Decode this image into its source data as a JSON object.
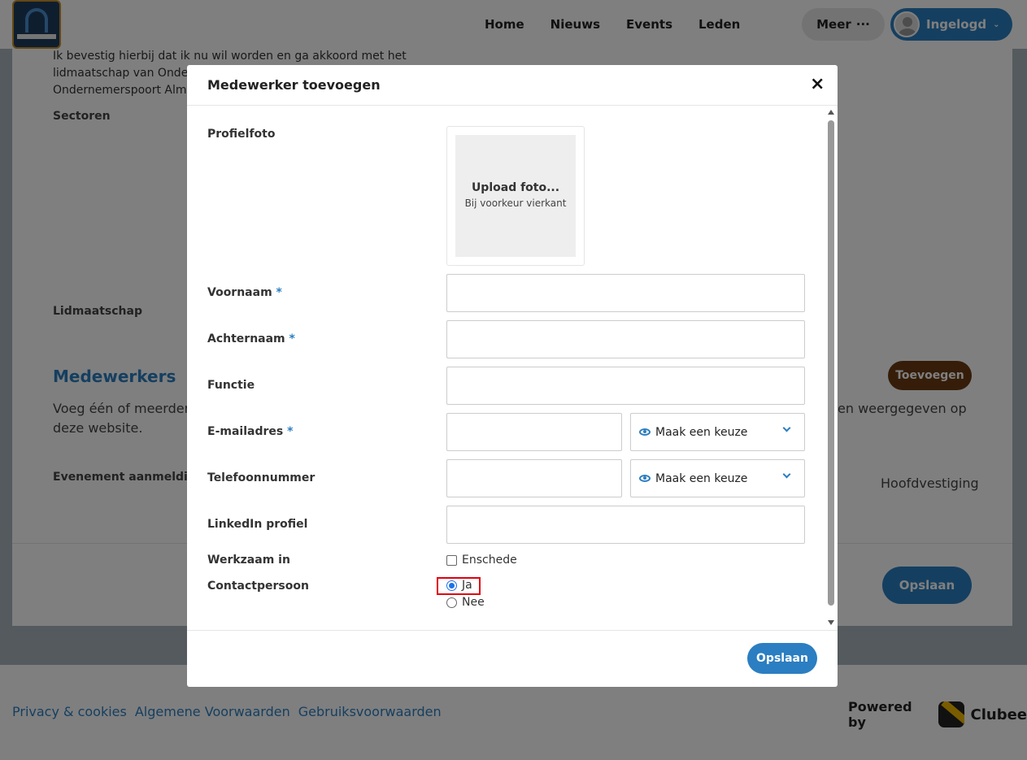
{
  "nav": {
    "links": [
      "Home",
      "Nieuws",
      "Events",
      "Leden"
    ],
    "meer_label": "Meer",
    "meer_icon": "···",
    "login_label": "Ingelogd"
  },
  "background": {
    "consent_lines": [
      "Ik bevestig hierbij dat ik nu wil worden en ga akkoord met het",
      "lidmaatschap van Onder",
      "Ondernemerspoort Alme"
    ],
    "sectoren_label": "Sectoren",
    "lidmaatschap_label": "Lidmaatschap",
    "medewerkers_heading": "Medewerkers",
    "toevoegen_label": "Toevoegen",
    "desc_left_line1": "Voeg één of meerdere",
    "desc_right_line1": "en weergegeven op",
    "desc_line2": "deze website.",
    "evenement_label": "Evenement aanmeldinge",
    "hoofdvestiging": "Hoofdvestiging",
    "opslaan_label": "Opslaan"
  },
  "footer": {
    "links": [
      "Privacy & cookies",
      "Algemene Voorwaarden",
      "Gebruiksvoorwaarden"
    ],
    "powered_by": "Powered by",
    "brand": "Clubee"
  },
  "modal": {
    "title": "Medewerker toevoegen",
    "close_icon": "×",
    "fields": {
      "profielfoto": "Profielfoto",
      "voornaam": "Voornaam",
      "achternaam": "Achternaam",
      "functie": "Functie",
      "email": "E-mailadres",
      "telefoon": "Telefoonnummer",
      "linkedin": "LinkedIn profiel",
      "werkzaam": "Werkzaam in",
      "contactpersoon": "Contactpersoon"
    },
    "required_mark": "*",
    "upload": {
      "title": "Upload foto...",
      "subtitle": "Bij voorkeur vierkant"
    },
    "select_placeholder": "Maak een keuze",
    "werkzaam_option": "Enschede",
    "contact_options": [
      "Ja",
      "Nee"
    ],
    "save_label": "Opslaan"
  }
}
